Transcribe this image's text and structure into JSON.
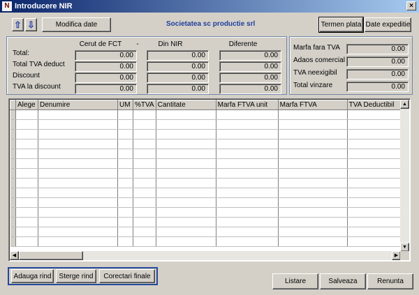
{
  "window": {
    "title": "Introducere NIR",
    "close_glyph": "×",
    "app_icon_glyph": "N"
  },
  "toolbar": {
    "up_icon": "up-arrow-icon",
    "down_icon": "down-arrow-icon",
    "modify_label": "Modifica date",
    "company": "Societatea  sc productie srl",
    "payment_terms_label": "Termen plata",
    "shipping_label": "Date expeditie"
  },
  "totals": {
    "col_headers": [
      "Cerut de FCT",
      "-",
      "Din NIR",
      "Diferente"
    ],
    "rows": [
      {
        "label": "Total:",
        "values": [
          "0.00",
          "0.00",
          "0.00"
        ]
      },
      {
        "label": "Total TVA deduct",
        "values": [
          "0.00",
          "0.00",
          "0.00"
        ]
      },
      {
        "label": "Discount",
        "values": [
          "0.00",
          "0.00",
          "0.00"
        ]
      },
      {
        "label": "TVA la discount",
        "values": [
          "0.00",
          "0.00",
          "0.00"
        ]
      }
    ]
  },
  "summary": {
    "rows": [
      {
        "label": "Marfa fara TVA",
        "value": "0.00"
      },
      {
        "label": "Adaos comercial",
        "value": "0.00"
      },
      {
        "label": "TVA neexigibil",
        "value": "0.00"
      },
      {
        "label": "Total vinzare",
        "value": "0.00"
      }
    ]
  },
  "grid": {
    "columns": [
      "Alege",
      "Denumire",
      "UM",
      "%TVA",
      "Cantitate",
      "Marfa FTVA unit",
      "Marfa FTVA",
      "TVA Deductibil"
    ],
    "empty_rows": 14
  },
  "bottom": {
    "add_row_label": "Adauga rind",
    "delete_row_label": "Sterge rind",
    "final_corrections_label": "Corectari finale",
    "list_label": "Listare",
    "save_label": "Salveaza",
    "cancel_label": "Renunta"
  },
  "colors": {
    "title_bar": "#0a246a",
    "company_text": "#1e3f9c",
    "bottom_group_border": "#22489a",
    "window_bg": "#d4d0c8"
  }
}
